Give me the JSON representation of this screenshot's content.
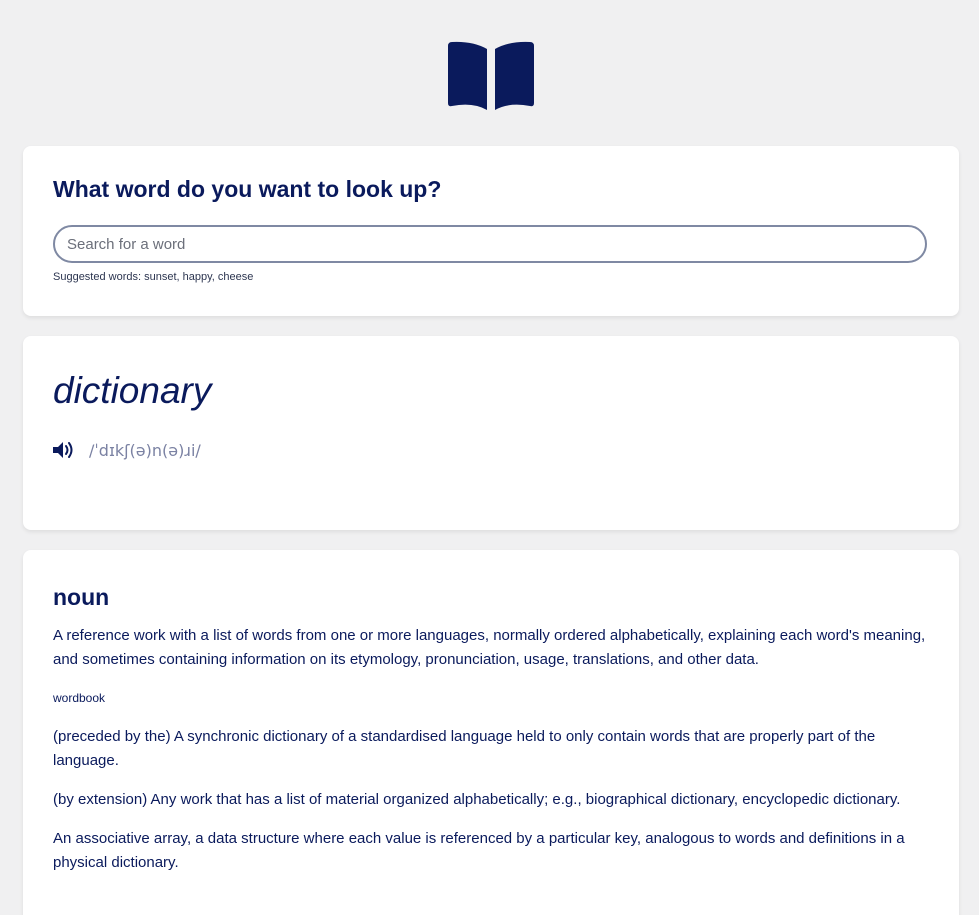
{
  "header": {
    "logo_icon": "open-book-icon",
    "logo_color": "#0a1a5c"
  },
  "search": {
    "title": "What word do you want to look up?",
    "placeholder": "Search for a word",
    "value": "",
    "suggested": "Suggested words: sunset, happy, cheese"
  },
  "word": {
    "text": "dictionary",
    "phonetic": "/ˈdɪkʃ(ə)n(ə)ɹi/",
    "audio_icon": "speaker-icon"
  },
  "meaning": {
    "part_of_speech": "noun",
    "definition_1": "A reference work with a list of words from one or more languages, normally ordered alphabetically, explaining each word's meaning, and sometimes containing information on its etymology, pronunciation, usage, translations, and other data.",
    "synonym": "wordbook",
    "definition_2": "(preceded by the) A synchronic dictionary of a standardised language held to only contain words that are properly part of the language.",
    "definition_3": "(by extension) Any work that has a list of material organized alphabetically; e.g., biographical dictionary, encyclopedic dictionary.",
    "definition_4": "An associative array, a data structure where each value is referenced by a particular key, analogous to words and definitions in a physical dictionary."
  },
  "colors": {
    "accent": "#0a1a5c",
    "background": "#f0f0f1",
    "card": "#ffffff",
    "phonetic": "#7b82a3"
  }
}
